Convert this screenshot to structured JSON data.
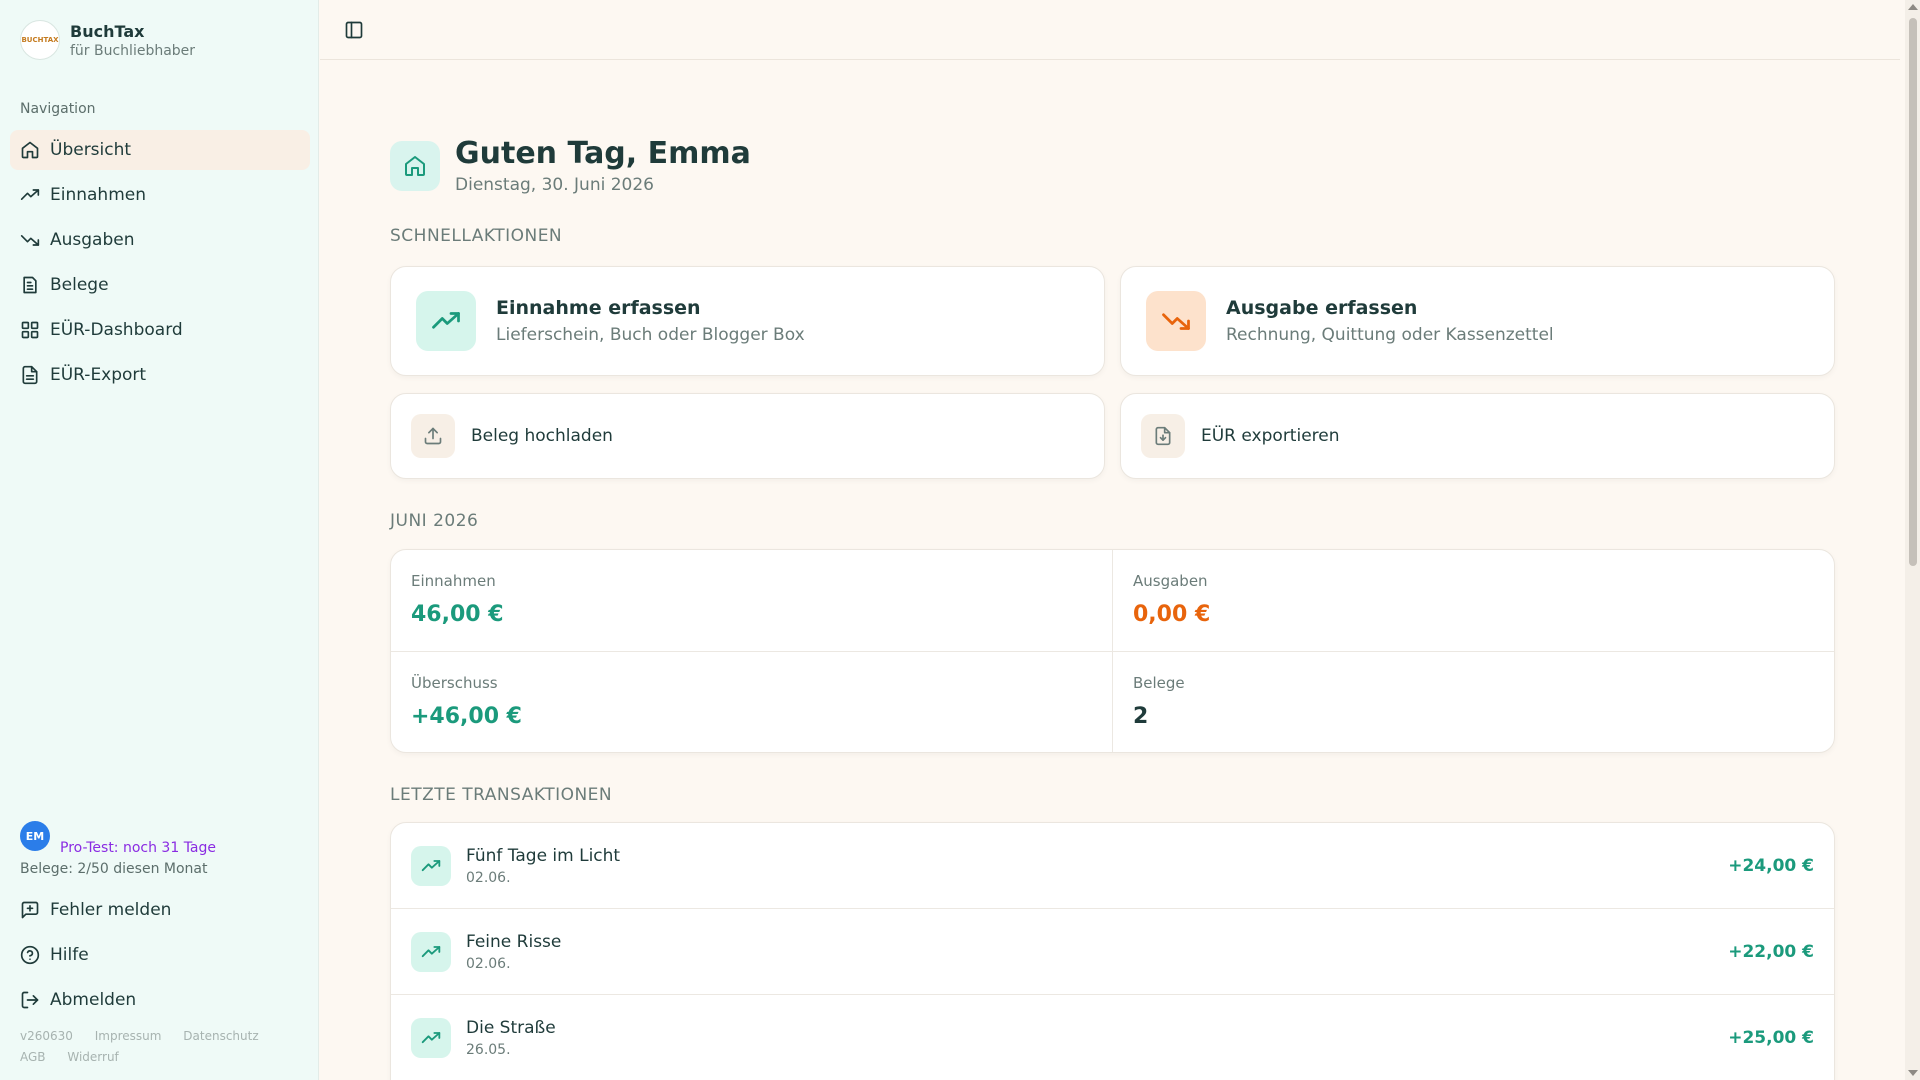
{
  "app": {
    "name": "BuchTax",
    "subtitle": "für Buchliebhaber",
    "logo_text": "BUCHTAX"
  },
  "sidebar": {
    "nav_heading": "Navigation",
    "items": [
      {
        "label": "Übersicht",
        "icon": "home-icon",
        "active": true
      },
      {
        "label": "Einnahmen",
        "icon": "trending-up-icon"
      },
      {
        "label": "Ausgaben",
        "icon": "trending-down-icon"
      },
      {
        "label": "Belege",
        "icon": "receipt-icon"
      },
      {
        "label": "EÜR-Dashboard",
        "icon": "dashboard-grid-icon"
      },
      {
        "label": "EÜR-Export",
        "icon": "file-text-icon"
      }
    ],
    "user": {
      "initials": "EM",
      "trial": "Pro-Test: noch 31 Tage",
      "belege_usage": "Belege: 2/50 diesen Monat"
    },
    "bottom_items": [
      {
        "label": "Fehler melden",
        "icon": "report-bug-icon"
      },
      {
        "label": "Hilfe",
        "icon": "help-circle-icon"
      },
      {
        "label": "Abmelden",
        "icon": "logout-icon"
      }
    ],
    "footer": {
      "version": "v260630",
      "impressum": "Impressum",
      "datenschutz": "Datenschutz",
      "agb": "AGB",
      "widerruf": "Widerruf"
    }
  },
  "main": {
    "greeting": "Guten Tag, Emma",
    "date": "Dienstag, 30. Juni 2026",
    "quick_actions_label": "SCHNELLAKTIONEN",
    "quick_actions": {
      "income": {
        "title": "Einnahme erfassen",
        "subtitle": "Lieferschein, Buch oder Blogger Box"
      },
      "expense": {
        "title": "Ausgabe erfassen",
        "subtitle": "Rechnung, Quittung oder Kassenzettel"
      },
      "upload": {
        "label": "Beleg hochladen"
      },
      "export": {
        "label": "EÜR exportieren"
      }
    },
    "month_label": "JUNI 2026",
    "stats": {
      "income_label": "Einnahmen",
      "income_value": "46,00 €",
      "expense_label": "Ausgaben",
      "expense_value": "0,00 €",
      "surplus_label": "Überschuss",
      "surplus_value": "+46,00 €",
      "receipts_label": "Belege",
      "receipts_value": "2"
    },
    "transactions_label": "LETZTE TRANSAKTIONEN",
    "transactions": [
      {
        "title": "Fünf Tage im Licht",
        "date": "02.06.",
        "amount": "+24,00 €"
      },
      {
        "title": "Feine Risse",
        "date": "02.06.",
        "amount": "+22,00 €"
      },
      {
        "title": "Die Straße",
        "date": "26.05.",
        "amount": "+25,00 €"
      }
    ]
  },
  "colors": {
    "accent_green": "#1b9a7c",
    "accent_orange": "#e8640c",
    "sidebar_bg": "#effaf7",
    "page_bg": "#fdf8f2"
  }
}
